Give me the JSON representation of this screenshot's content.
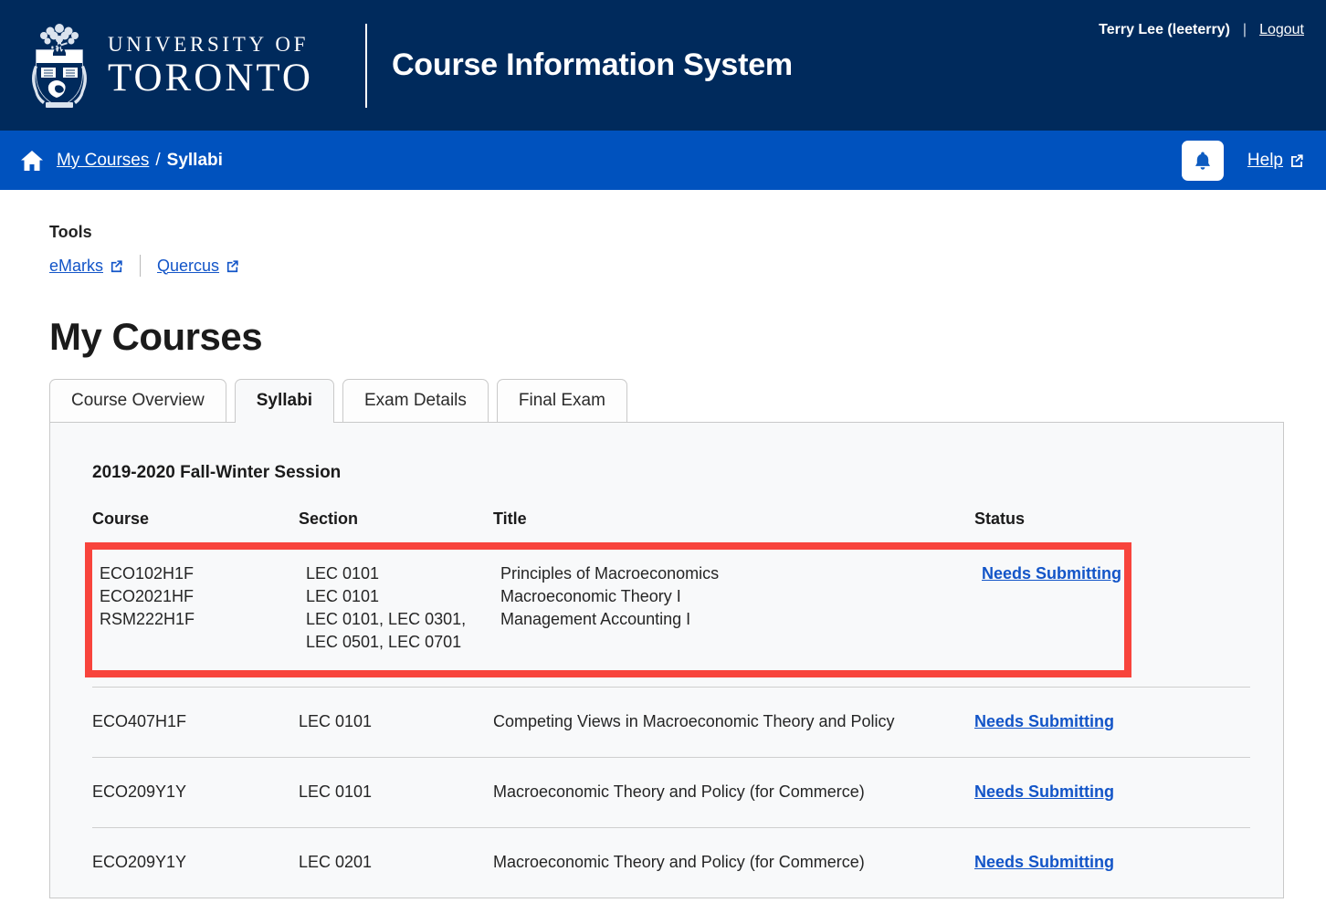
{
  "header": {
    "logo_line1": "UNIVERSITY OF",
    "logo_line2": "TORONTO",
    "app_title": "Course Information System",
    "user_name": "Terry Lee (leeterry)",
    "separator": "|",
    "logout_label": "Logout"
  },
  "nav": {
    "home_icon": "home-icon",
    "breadcrumb_parent": "My Courses",
    "breadcrumb_separator": "/",
    "breadcrumb_current": "Syllabi",
    "bell_icon": "bell-icon",
    "help_label": "Help",
    "help_external_icon": "external-link-icon"
  },
  "tools": {
    "heading": "Tools",
    "links": [
      {
        "label": "eMarks",
        "icon": "external-link-icon"
      },
      {
        "label": "Quercus",
        "icon": "external-link-icon"
      }
    ]
  },
  "main": {
    "page_title": "My Courses",
    "tabs": [
      {
        "label": "Course Overview",
        "active": false
      },
      {
        "label": "Syllabi",
        "active": true
      },
      {
        "label": "Exam Details",
        "active": false
      },
      {
        "label": "Final Exam",
        "active": false
      }
    ],
    "session_title": "2019-2020 Fall-Winter Session",
    "columns": {
      "course": "Course",
      "section": "Section",
      "title": "Title",
      "status": "Status"
    },
    "highlighted_rows": [
      {
        "course": "ECO102H1F",
        "section": "LEC 0101",
        "title": "Principles of Macroeconomics",
        "status": "Needs Submitting"
      },
      {
        "course": "ECO2021HF",
        "section": "LEC 0101",
        "title": "Macroeconomic Theory I",
        "status": ""
      },
      {
        "course": "RSM222H1F",
        "section": "LEC 0101, LEC 0301, LEC 0501, LEC 0701",
        "title": "Management Accounting I",
        "status": ""
      }
    ],
    "rows": [
      {
        "course": "ECO407H1F",
        "section": "LEC 0101",
        "title": "Competing Views in Macroeconomic Theory and Policy",
        "status": "Needs Submitting"
      },
      {
        "course": "ECO209Y1Y",
        "section": "LEC 0101",
        "title": "Macroeconomic Theory and Policy (for Commerce)",
        "status": "Needs Submitting"
      },
      {
        "course": "ECO209Y1Y",
        "section": "LEC 0201",
        "title": "Macroeconomic Theory and Policy (for Commerce)",
        "status": "Needs Submitting"
      }
    ]
  },
  "colors": {
    "header_navy": "#002a5c",
    "nav_blue": "#0052be",
    "link_blue": "#1355c8",
    "highlight_red": "#f8443c",
    "panel_bg": "#f8f9fa"
  }
}
